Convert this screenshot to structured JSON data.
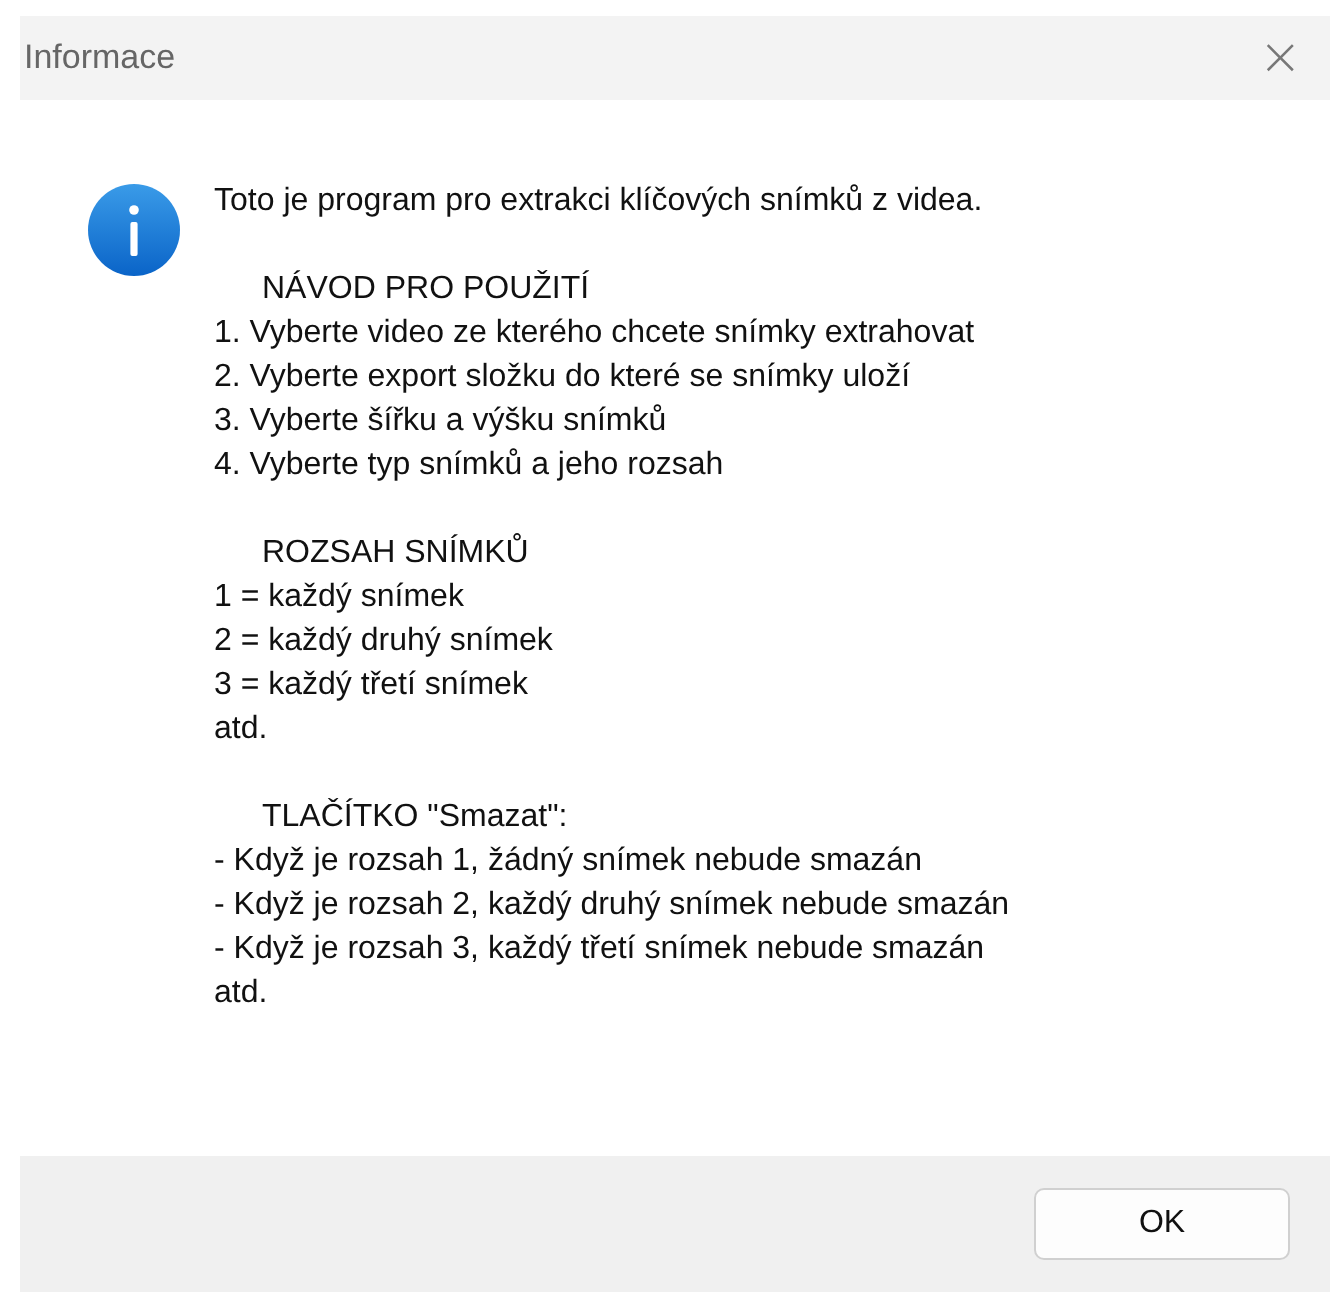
{
  "window": {
    "title": "Informace",
    "close": "×"
  },
  "message": {
    "intro": "Toto je program pro extrakci klíčových snímků z videa.",
    "sections": [
      {
        "heading": "NÁVOD PRO POUŽITÍ",
        "lines": [
          "1. Vyberte video ze kterého chcete snímky extrahovat",
          "2. Vyberte export složku do které se snímky uloží",
          "3. Vyberte šířku a výšku snímků",
          "4. Vyberte typ snímků a jeho rozsah"
        ]
      },
      {
        "heading": "ROZSAH SNÍMKŮ",
        "lines": [
          "1 = každý snímek",
          "2 = každý druhý snímek",
          "3 = každý třetí snímek",
          "atd."
        ]
      },
      {
        "heading": "TLAČÍTKO \"Smazat\":",
        "lines": [
          "- Když je rozsah 1, žádný snímek nebude smazán",
          "- Když je rozsah 2, každý druhý snímek nebude smazán",
          "- Když je rozsah 3, každý třetí snímek nebude smazán",
          "atd."
        ]
      }
    ]
  },
  "buttons": [
    "OK"
  ]
}
